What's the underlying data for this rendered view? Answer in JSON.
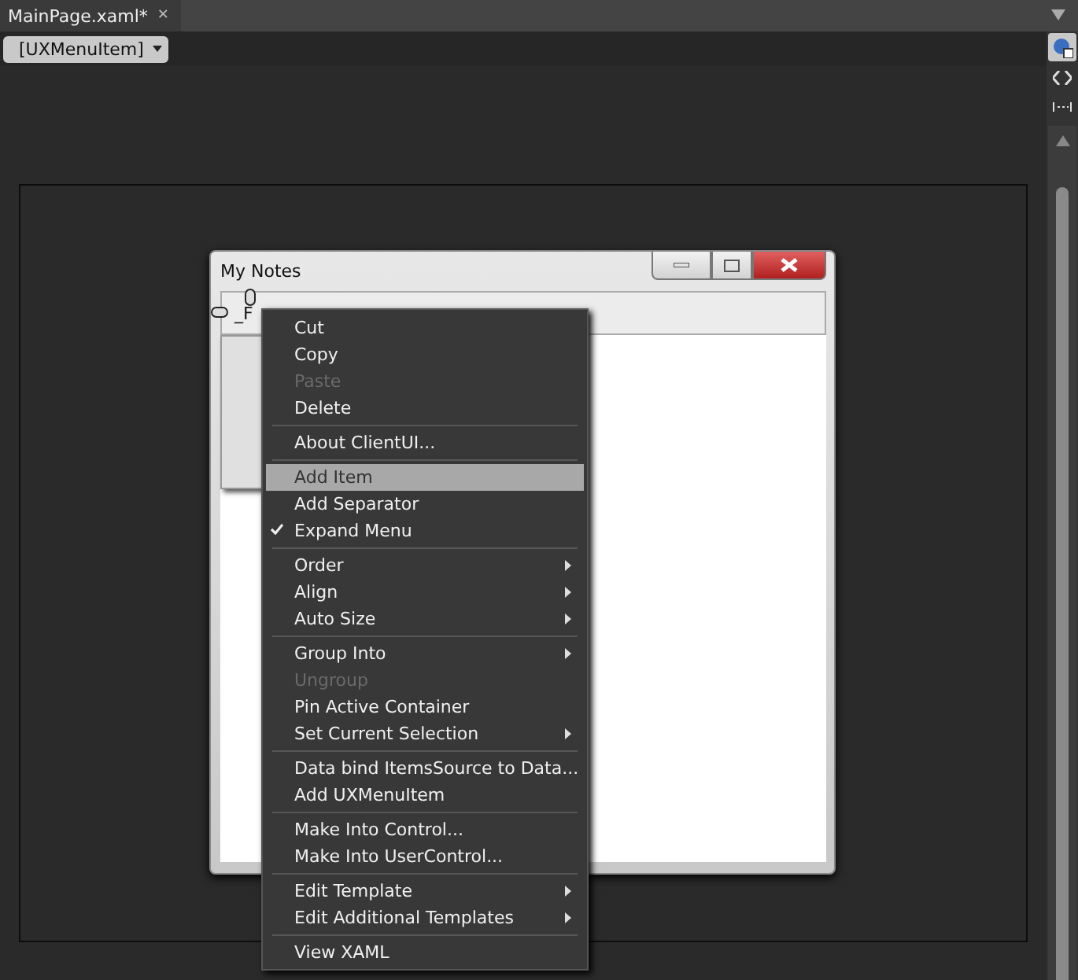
{
  "document_tab": {
    "title": "MainPage.xaml*",
    "close": "✕"
  },
  "breadcrumb": {
    "label": "[UXMenuItem]"
  },
  "design_window": {
    "title": "My Notes",
    "menu_item": "_F"
  },
  "context_menu": [
    {
      "kind": "item",
      "label": "Cut",
      "disabled": false,
      "selected": false,
      "checked": false,
      "submenu": false
    },
    {
      "kind": "item",
      "label": "Copy",
      "disabled": false,
      "selected": false,
      "checked": false,
      "submenu": false
    },
    {
      "kind": "item",
      "label": "Paste",
      "disabled": true,
      "selected": false,
      "checked": false,
      "submenu": false
    },
    {
      "kind": "item",
      "label": "Delete",
      "disabled": false,
      "selected": false,
      "checked": false,
      "submenu": false
    },
    {
      "kind": "separator"
    },
    {
      "kind": "item",
      "label": "About ClientUI...",
      "disabled": false,
      "selected": false,
      "checked": false,
      "submenu": false
    },
    {
      "kind": "separator"
    },
    {
      "kind": "item",
      "label": "Add Item",
      "disabled": false,
      "selected": true,
      "checked": false,
      "submenu": false
    },
    {
      "kind": "item",
      "label": "Add Separator",
      "disabled": false,
      "selected": false,
      "checked": false,
      "submenu": false
    },
    {
      "kind": "item",
      "label": "Expand Menu",
      "disabled": false,
      "selected": false,
      "checked": true,
      "submenu": false
    },
    {
      "kind": "separator"
    },
    {
      "kind": "item",
      "label": "Order",
      "disabled": false,
      "selected": false,
      "checked": false,
      "submenu": true
    },
    {
      "kind": "item",
      "label": "Align",
      "disabled": false,
      "selected": false,
      "checked": false,
      "submenu": true
    },
    {
      "kind": "item",
      "label": "Auto Size",
      "disabled": false,
      "selected": false,
      "checked": false,
      "submenu": true
    },
    {
      "kind": "separator"
    },
    {
      "kind": "item",
      "label": "Group Into",
      "disabled": false,
      "selected": false,
      "checked": false,
      "submenu": true
    },
    {
      "kind": "item",
      "label": "Ungroup",
      "disabled": true,
      "selected": false,
      "checked": false,
      "submenu": false
    },
    {
      "kind": "item",
      "label": "Pin Active Container",
      "disabled": false,
      "selected": false,
      "checked": false,
      "submenu": false
    },
    {
      "kind": "item",
      "label": "Set Current Selection",
      "disabled": false,
      "selected": false,
      "checked": false,
      "submenu": true
    },
    {
      "kind": "separator"
    },
    {
      "kind": "item",
      "label": "Data bind ItemsSource to Data...",
      "disabled": false,
      "selected": false,
      "checked": false,
      "submenu": false
    },
    {
      "kind": "item",
      "label": "Add UXMenuItem",
      "disabled": false,
      "selected": false,
      "checked": false,
      "submenu": false
    },
    {
      "kind": "separator"
    },
    {
      "kind": "item",
      "label": "Make Into Control...",
      "disabled": false,
      "selected": false,
      "checked": false,
      "submenu": false
    },
    {
      "kind": "item",
      "label": "Make Into UserControl...",
      "disabled": false,
      "selected": false,
      "checked": false,
      "submenu": false
    },
    {
      "kind": "separator"
    },
    {
      "kind": "item",
      "label": "Edit Template",
      "disabled": false,
      "selected": false,
      "checked": false,
      "submenu": true
    },
    {
      "kind": "item",
      "label": "Edit Additional Templates",
      "disabled": false,
      "selected": false,
      "checked": false,
      "submenu": true
    },
    {
      "kind": "separator"
    },
    {
      "kind": "item",
      "label": "View XAML",
      "disabled": false,
      "selected": false,
      "checked": false,
      "submenu": false
    }
  ]
}
